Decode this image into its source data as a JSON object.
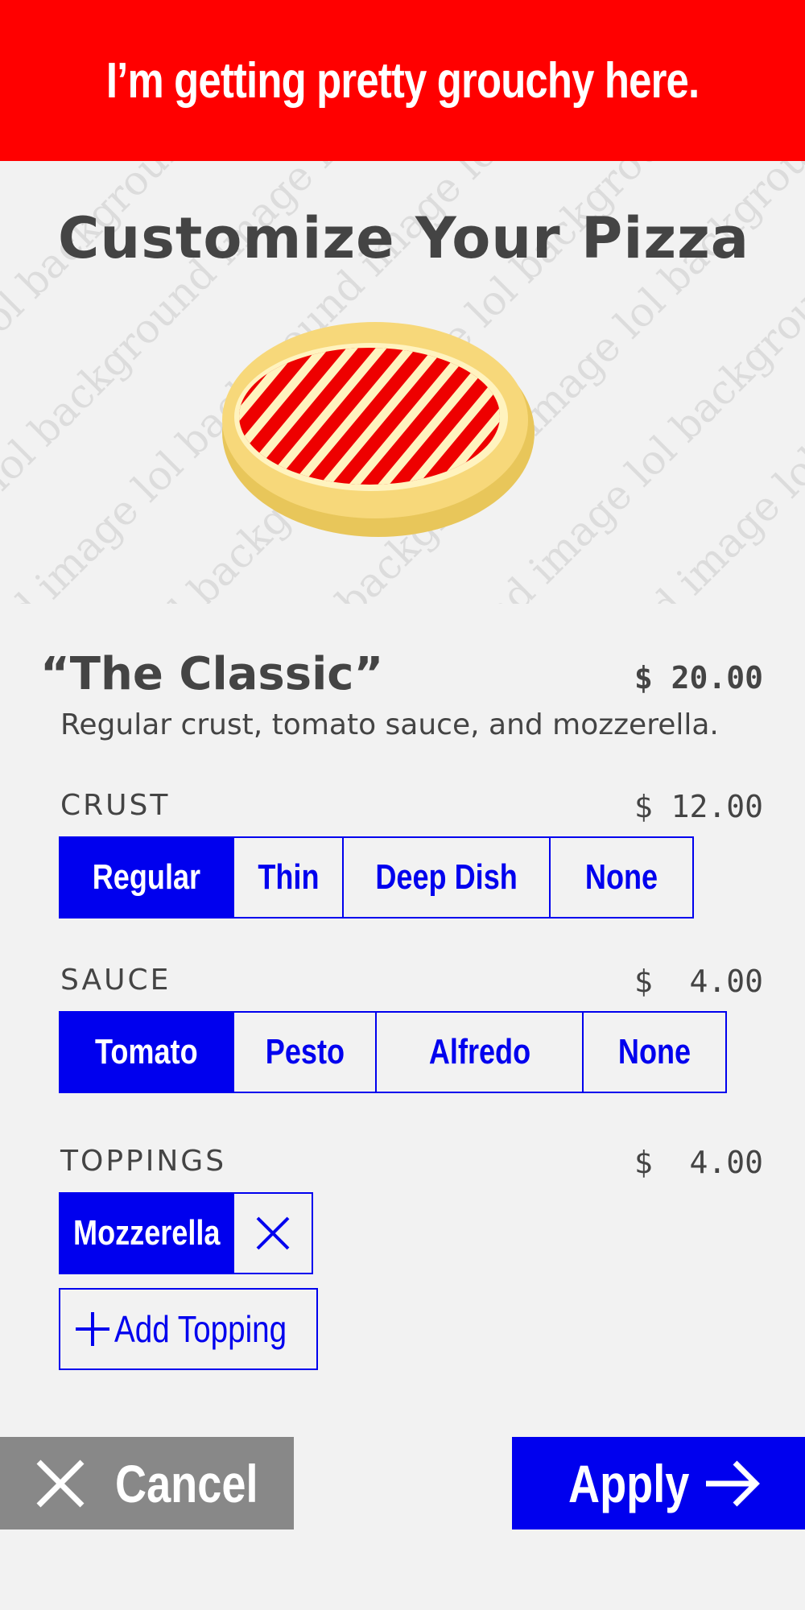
{
  "banner": {
    "text": "I’m getting pretty grouchy here."
  },
  "hero": {
    "watermark_text": "background image lol"
  },
  "page": {
    "title": "Customize Your Pizza"
  },
  "product": {
    "name": "“The Classic”",
    "price": "$ 20.00",
    "description": "Regular crust, tomato sauce, and mozzerella."
  },
  "crust": {
    "label": "CRUST",
    "price": "$ 12.00",
    "options": [
      "Regular",
      "Thin",
      "Deep Dish",
      "None"
    ],
    "selected": "Regular"
  },
  "sauce": {
    "label": "SAUCE",
    "price": "$  4.00",
    "options": [
      "Tomato",
      "Pesto",
      "Alfredo",
      "None"
    ],
    "selected": "Tomato"
  },
  "toppings": {
    "label": "TOPPINGS",
    "price": "$  4.00",
    "selected_items": [
      "Mozzerella"
    ],
    "add_label": "Add Topping"
  },
  "actions": {
    "cancel_label": "Cancel",
    "apply_label": "Apply"
  },
  "colors": {
    "banner": "#ff0000",
    "accent": "#0000ee",
    "cancel": "#888888",
    "background": "#f2f2f2",
    "text": "#444444"
  },
  "icons": {
    "remove": "close-icon",
    "add": "plus-icon",
    "cancel": "close-icon",
    "apply": "arrow-right-icon"
  }
}
